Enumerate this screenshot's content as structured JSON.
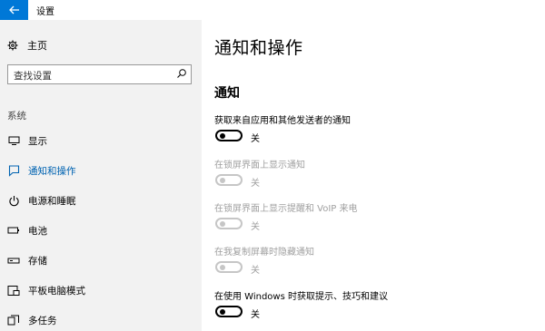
{
  "window": {
    "title": "设置"
  },
  "sidebar": {
    "home_label": "主页",
    "search_placeholder": "查找设置",
    "section_label": "系统",
    "items": [
      {
        "label": "显示",
        "icon": "monitor-icon",
        "active": false
      },
      {
        "label": "通知和操作",
        "icon": "chat-bubble-icon",
        "active": true
      },
      {
        "label": "电源和睡眠",
        "icon": "power-icon",
        "active": false
      },
      {
        "label": "电池",
        "icon": "battery-icon",
        "active": false
      },
      {
        "label": "存储",
        "icon": "storage-drive-icon",
        "active": false
      },
      {
        "label": "平板电脑模式",
        "icon": "tablet-mode-icon",
        "active": false
      },
      {
        "label": "多任务",
        "icon": "multitasking-icon",
        "active": false
      }
    ]
  },
  "main": {
    "page_title": "通知和操作",
    "section_title": "通知",
    "settings": [
      {
        "label": "获取来自应用和其他发送者的通知",
        "state": "关",
        "enabled": true
      },
      {
        "label": "在锁屏界面上显示通知",
        "state": "关",
        "enabled": false
      },
      {
        "label": "在锁屏界面上显示提醒和 VoIP 来电",
        "state": "关",
        "enabled": false
      },
      {
        "label": "在我复制屏幕时隐藏通知",
        "state": "关",
        "enabled": false
      },
      {
        "label": "在使用 Windows 时获取提示、技巧和建议",
        "state": "关",
        "enabled": true
      }
    ]
  },
  "colors": {
    "accent": "#0078d7",
    "sidebar_bg": "#f2f2f2",
    "disabled": "#a0a0a0"
  }
}
